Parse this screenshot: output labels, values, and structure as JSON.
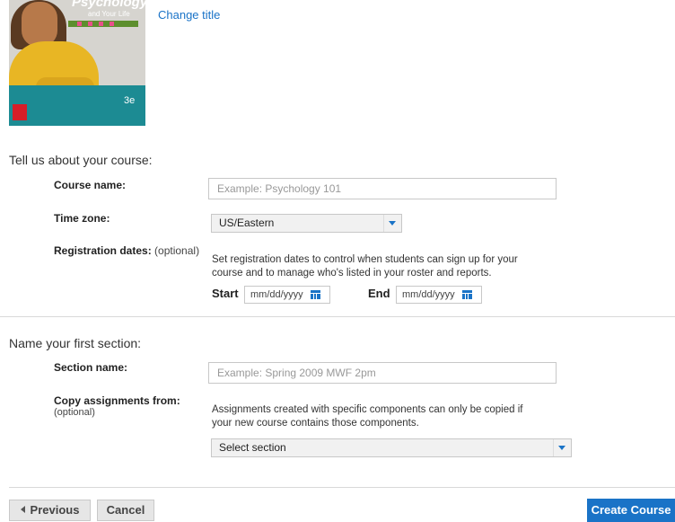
{
  "book": {
    "title_line": "Psychology",
    "subtitle": "and Your Life",
    "edition": "3e"
  },
  "header": {
    "change_title_label": "Change title"
  },
  "course_section": {
    "heading": "Tell us about your course:",
    "course_name_label": "Course name:",
    "course_name_placeholder": "Example: Psychology 101",
    "time_zone_label": "Time zone:",
    "time_zone_value": "US/Eastern",
    "registration_label": "Registration dates:",
    "registration_optional": "(optional)",
    "registration_help_line1": "Set registration dates to control when students can sign up for your",
    "registration_help_line2": "course and to manage who's listed in your roster and reports.",
    "start_label": "Start",
    "start_placeholder": "mm/dd/yyyy",
    "end_label": "End",
    "end_placeholder": "mm/dd/yyyy"
  },
  "section_section": {
    "heading": "Name your first section:",
    "section_name_label": "Section name:",
    "section_name_placeholder": "Example: Spring 2009 MWF 2pm",
    "copy_label": "Copy assignments from:",
    "copy_optional": "(optional)",
    "copy_help_line1": "Assignments created with specific components can only be copied if",
    "copy_help_line2": "your new course contains those components.",
    "copy_select_value": "Select section"
  },
  "footer": {
    "previous_label": "Previous",
    "cancel_label": "Cancel",
    "create_label": "Create Course"
  },
  "colors": {
    "accent": "#1a73c7",
    "cover_teal": "#1c8b93"
  }
}
